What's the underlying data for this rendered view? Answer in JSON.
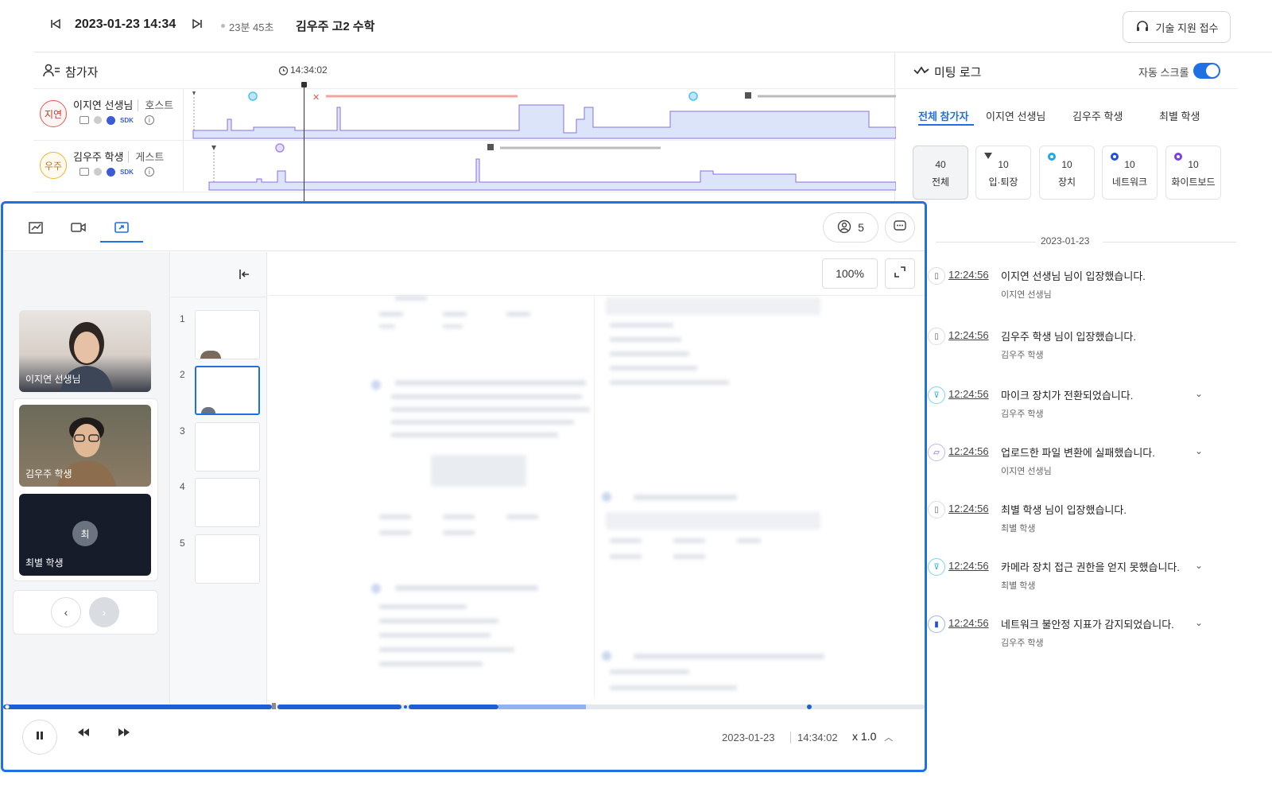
{
  "topbar": {
    "datetime": "2023-01-23 14:34",
    "duration": "23분 45초",
    "title": "김우주 고2 수학",
    "support_label": "기술 지원 접수"
  },
  "participants": {
    "header": "참가자",
    "current_time": "14:34:02",
    "rows": [
      {
        "avatar": "지연",
        "name": "이지연 선생님",
        "role": "호스트",
        "avatar_color": "#e8574f"
      },
      {
        "avatar": "우주",
        "name": "김우주 학생",
        "role": "게스트",
        "avatar_color": "#f0b429"
      }
    ]
  },
  "meeting_log": {
    "title": "미팅 로그",
    "auto_scroll_label": "자동 스크롤",
    "tabs": [
      "전체 참가자",
      "이지연 선생님",
      "김우주 학생",
      "최별 학생"
    ],
    "filters": [
      {
        "count": "40",
        "name": "전체"
      },
      {
        "count": "10",
        "name": "입·퇴장"
      },
      {
        "count": "10",
        "name": "장치"
      },
      {
        "count": "10",
        "name": "네트워크"
      },
      {
        "count": "10",
        "name": "화이트보드"
      }
    ],
    "date": "2023-01-23",
    "entries": [
      {
        "time": "12:24:56",
        "message": "이지연 선생님 님이 입장했습니다.",
        "who": "이지연 선생님",
        "expandable": false
      },
      {
        "time": "12:24:56",
        "message": "김우주 학생 님이 입장했습니다.",
        "who": "김우주 학생",
        "expandable": false
      },
      {
        "time": "12:24:56",
        "message": "마이크 장치가 전환되었습니다.",
        "who": "김우주 학생",
        "expandable": true
      },
      {
        "time": "12:24:56",
        "message": "업로드한 파일 변환에 실패했습니다.",
        "who": "이지연 선생님",
        "expandable": true
      },
      {
        "time": "12:24:56",
        "message": "최별 학생 님이 입장했습니다.",
        "who": "최별 학생",
        "expandable": false
      },
      {
        "time": "12:24:56",
        "message": "카메라 장치 접근 권한을 얻지 못했습니다.",
        "who": "최별 학생",
        "expandable": true
      },
      {
        "time": "12:24:56",
        "message": "네트워크 불안정 지표가 감지되었습니다.",
        "who": "김우주 학생",
        "expandable": true
      }
    ]
  },
  "player": {
    "participant_count": "5",
    "videos": [
      {
        "name": "이지연 선생님"
      },
      {
        "name": "김우주 학생"
      },
      {
        "name": "최별 학생",
        "initial": "최"
      }
    ],
    "pages": [
      "1",
      "2",
      "3",
      "4",
      "5"
    ],
    "zoom": "100%",
    "date": "2023-01-23",
    "time": "14:34:02",
    "speed": "x 1.0"
  }
}
